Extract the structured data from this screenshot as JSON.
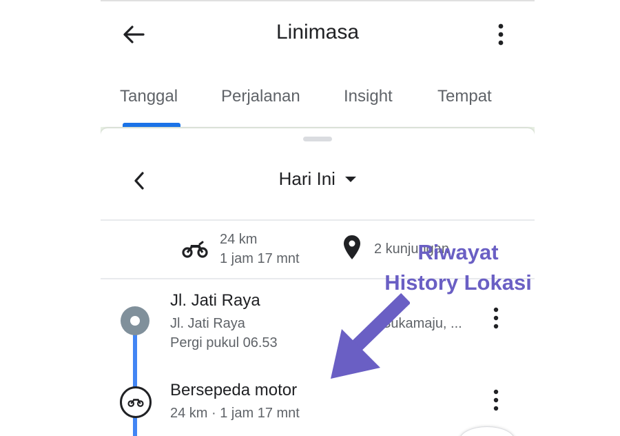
{
  "appbar": {
    "title": "Linimasa",
    "back_icon": "arrow-left-icon",
    "menu_icon": "more-vertical-icon"
  },
  "tabs": [
    {
      "label": "Tanggal",
      "active": true
    },
    {
      "label": "Perjalanan",
      "active": false
    },
    {
      "label": "Insight",
      "active": false
    },
    {
      "label": "Tempat",
      "active": false
    }
  ],
  "date_nav": {
    "label": "Hari Ini",
    "prev_icon": "chevron-left-icon",
    "dropdown_icon": "caret-down-icon"
  },
  "summary": {
    "distance": "24 km",
    "duration": "1 jam 17 mnt",
    "visits": "2 kunjungan",
    "motor_icon": "motorcycle-icon",
    "place_icon": "location-pin-icon"
  },
  "timeline": [
    {
      "type": "place",
      "title": "Jl. Jati Raya",
      "subtitle": "Jl. Jati Raya",
      "address_tail": "Sukamaju, ...",
      "time": "Pergi pukul 06.53"
    },
    {
      "type": "activity",
      "title": "Bersepeda motor",
      "details": "24 km · 1 jam 17 mnt",
      "icon": "motorcycle-icon"
    }
  ],
  "annotation": {
    "line1": "Riwayat",
    "line2": "History Lokasi"
  },
  "colors": {
    "accent": "#1a73e8",
    "timeline": "#4285f4",
    "annotation": "#6a5fc4",
    "place_dot": "#80909b"
  }
}
